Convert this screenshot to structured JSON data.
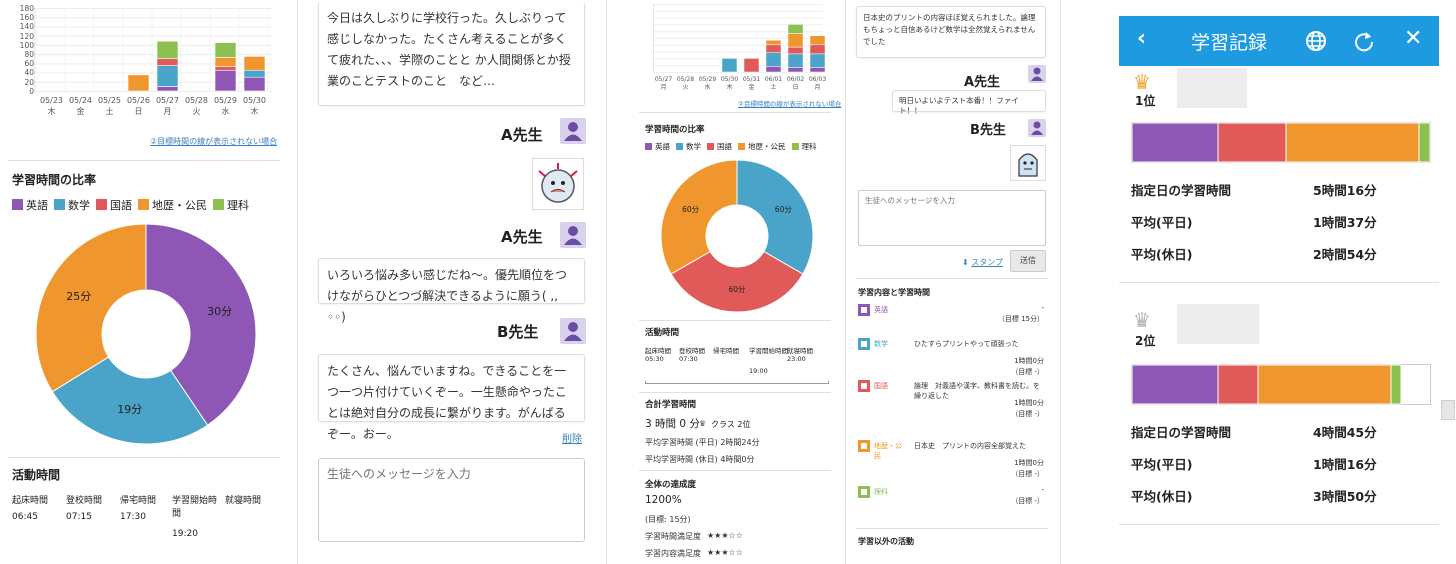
{
  "p1": {
    "bar_x": [
      "05/23",
      "05/24",
      "05/25",
      "05/26",
      "05/27",
      "05/28",
      "05/29",
      "05/30"
    ],
    "bar_w": [
      "木",
      "金",
      "土",
      "日",
      "月",
      "火",
      "水",
      "木"
    ],
    "bar_y": [
      "180",
      "160",
      "140",
      "120",
      "100",
      "80",
      "60",
      "40",
      "20",
      "0"
    ],
    "link": "②目標時間の線が表示されない場合",
    "ratio_title": "学習時間の比率",
    "legend": [
      "英語",
      "数学",
      "国語",
      "地歴・公民",
      "理科"
    ],
    "pie_labels": [
      "30分",
      "19分",
      "25分"
    ],
    "act_title": "活動時間",
    "act_headers": [
      "起床時間",
      "登校時間",
      "帰宅時間",
      "学習開始時",
      "就寝時間"
    ],
    "act_header_extra": "間",
    "act_values": [
      "06:45",
      "07:15",
      "17:30",
      "19:20",
      ""
    ]
  },
  "p2": {
    "msg1": "今日は久しぶりに学校行った。久しぶりって感じしなかった。たくさん考えることが多くて疲れた、、、学際のことと か人間関係とか授業のことテストのこと　など…",
    "teacher_a": "A先生",
    "teacher_b": "B先生",
    "msg2": "いろいろ悩み多い感じだね〜。優先順位をつけながらひとつづ解決できるように願う( ,, ◦◦)",
    "msg3": "たくさん、悩んでいますね。できることを一つ一つ片付けていくぞー。一生懸命やったことは絶対自分の成長に繋がります。がんばるぞー。おー。",
    "delete": "削除",
    "input_placeholder": "生徒へのメッセージを入力"
  },
  "p3": {
    "bar_x": [
      "05/27",
      "05/28",
      "05/29",
      "05/30",
      "05/31",
      "06/01",
      "06/02",
      "06/03"
    ],
    "bar_w": [
      "月",
      "火",
      "水",
      "木",
      "金",
      "土",
      "日",
      "月"
    ],
    "link": "②目標時間の線が表示されない場合",
    "ratio_title": "学習時間の比率",
    "legend": [
      "英語",
      "数学",
      "国語",
      "地歴・公民",
      "理科"
    ],
    "pie_labels": [
      "60分",
      "60分",
      "60分"
    ],
    "act_title": "活動時間",
    "act_headers": [
      "起床時間",
      "登校時間",
      "帰宅時間",
      "学習開始時間",
      "就寝時間"
    ],
    "act_values": [
      "05:30",
      "07:30",
      "",
      "19:00",
      "23:00"
    ],
    "total_title": "合計学習時間",
    "total_value": "3 時間 0 分",
    "class_rank": "クラス 2位",
    "avg_weekday": "平均学習時間 (平日) 2時間24分",
    "avg_holiday": "平均学習時間 (休日) 4時間0分",
    "achieve_title": "全体の達成度",
    "achieve_value": "1200%",
    "achieve_goal": "(目標: 15分)",
    "sat1_label": "学習時間満足度",
    "sat2_label": "学習内容満足度",
    "stars": "★★★☆☆"
  },
  "p4": {
    "top_msg": "日本史のプリントの内容ほぼ覚えられました。論理もちょっと自信あるけど数学は全然覚えられませんでした",
    "teacher_a": "A先生",
    "teacher_b": "B先生",
    "a_msg": "明日いよいよテスト本番！！ファイト！！",
    "input_placeholder": "生徒へのメッセージを入力",
    "stamp": "スタンプ",
    "send": "送信",
    "content_title": "学習内容と学習時間",
    "subjects": [
      {
        "name": "英語",
        "color": "#8e57b5",
        "text": "",
        "dash": "-",
        "time": "（目標 15分）"
      },
      {
        "name": "数学",
        "color": "#4aa3c8",
        "text": "ひたすらプリントやって頑張った",
        "dash": "",
        "time": "1時間0分\n（目標 -）"
      },
      {
        "name": "国語",
        "color": "#e05a5a",
        "text": "論理　対義語や漢字、教科書を読む。を繰り返した",
        "dash": "",
        "time": "1時間0分\n（目標 -）"
      },
      {
        "name": "地歴・公民",
        "color": "#f0962e",
        "text": "日本史　プリントの内容全部覚えた",
        "dash": "",
        "time": "1時間0分\n（目標 -）"
      },
      {
        "name": "理科",
        "color": "#8cc152",
        "text": "",
        "dash": "-",
        "time": "（目標 -）"
      }
    ],
    "other_title": "学習以外の活動"
  },
  "p5": {
    "title": "学習記録",
    "rank1": "1位",
    "rank2": "2位",
    "lbl_day": "指定日の学習時間",
    "lbl_weekday": "平均(平日)",
    "lbl_holiday": "平均(休日)",
    "r1": [
      "5時間16分",
      "1時間37分",
      "2時間54分"
    ],
    "r2": [
      "4時間45分",
      "1時間16分",
      "3時間50分"
    ],
    "header_color": "#1e9be0"
  },
  "colors": {
    "english": "#8e57b5",
    "math": "#4aa3c8",
    "japanese": "#e05a5a",
    "history": "#f0962e",
    "science": "#8cc152"
  }
}
